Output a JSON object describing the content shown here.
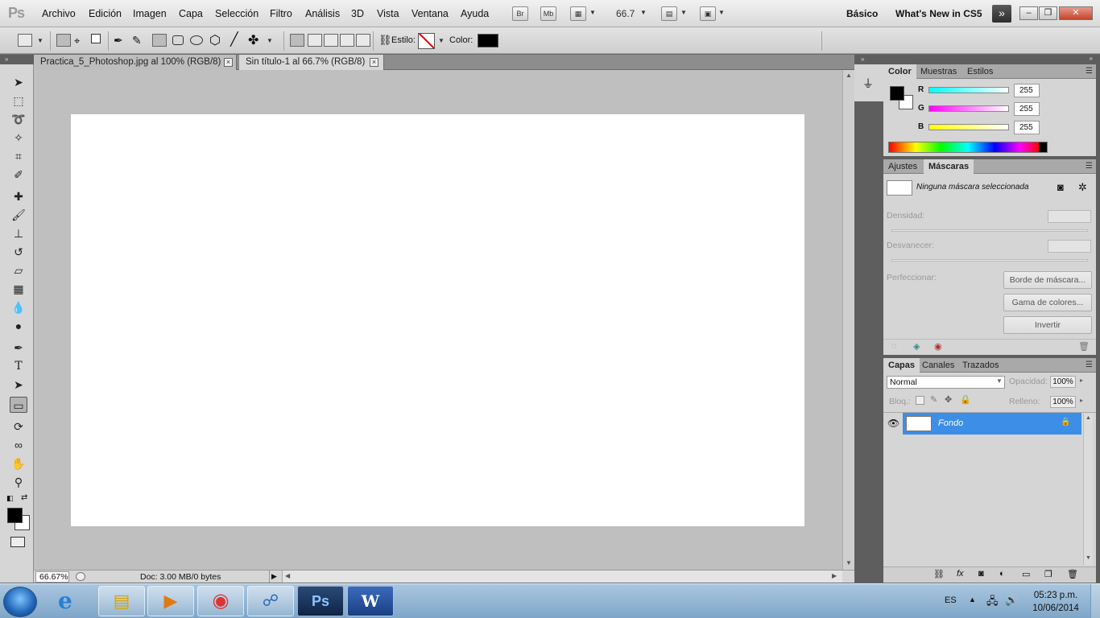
{
  "app": {
    "logo": "Ps"
  },
  "menu": [
    "Archivo",
    "Edición",
    "Imagen",
    "Capa",
    "Selección",
    "Filtro",
    "Análisis",
    "3D",
    "Vista",
    "Ventana",
    "Ayuda"
  ],
  "appbar": {
    "bridge": "Br",
    "minibridge": "Mb",
    "zoom": "66.7",
    "workspaces": [
      "Básico",
      "What's New in CS5"
    ]
  },
  "options": {
    "style_label": "Estilo:",
    "color_label": "Color:"
  },
  "documents": {
    "tabs": [
      {
        "label": "Practica_5_Photoshop.jpg al 100% (RGB/8)",
        "active": false
      },
      {
        "label": "Sin título-1 al 66.7% (RGB/8)",
        "active": true
      }
    ]
  },
  "status": {
    "zoom": "66.67%",
    "doc_info": "Doc: 3.00 MB/0 bytes"
  },
  "color_panel": {
    "tabs": [
      "Color",
      "Muestras",
      "Estilos"
    ],
    "channels": [
      {
        "label": "R",
        "value": "255",
        "track": "#00f0f0"
      },
      {
        "label": "G",
        "value": "255",
        "track": "#f020f0"
      },
      {
        "label": "B",
        "value": "255",
        "track": "#f0f000"
      }
    ]
  },
  "masks_panel": {
    "tabs": [
      "Ajustes",
      "Máscaras"
    ],
    "none_text": "Ninguna máscara seleccionada",
    "density_label": "Densidad:",
    "feather_label": "Desvanecer:",
    "refine_label": "Perfeccionar:",
    "buttons": [
      "Borde de máscara...",
      "Gama de colores...",
      "Invertir"
    ]
  },
  "layers_panel": {
    "tabs": [
      "Capas",
      "Canales",
      "Trazados"
    ],
    "blend_mode": "Normal",
    "opacity_label": "Opacidad:",
    "opacity_value": "100%",
    "lock_label": "Bloq.:",
    "fill_label": "Relleno:",
    "fill_value": "100%",
    "layers": [
      {
        "name": "Fondo"
      }
    ]
  },
  "taskbar": {
    "language": "ES",
    "time": "05:23 p.m.",
    "date": "10/06/2014",
    "apps": [
      "explorer",
      "media-player",
      "chrome",
      "network",
      "photoshop",
      "word"
    ]
  }
}
